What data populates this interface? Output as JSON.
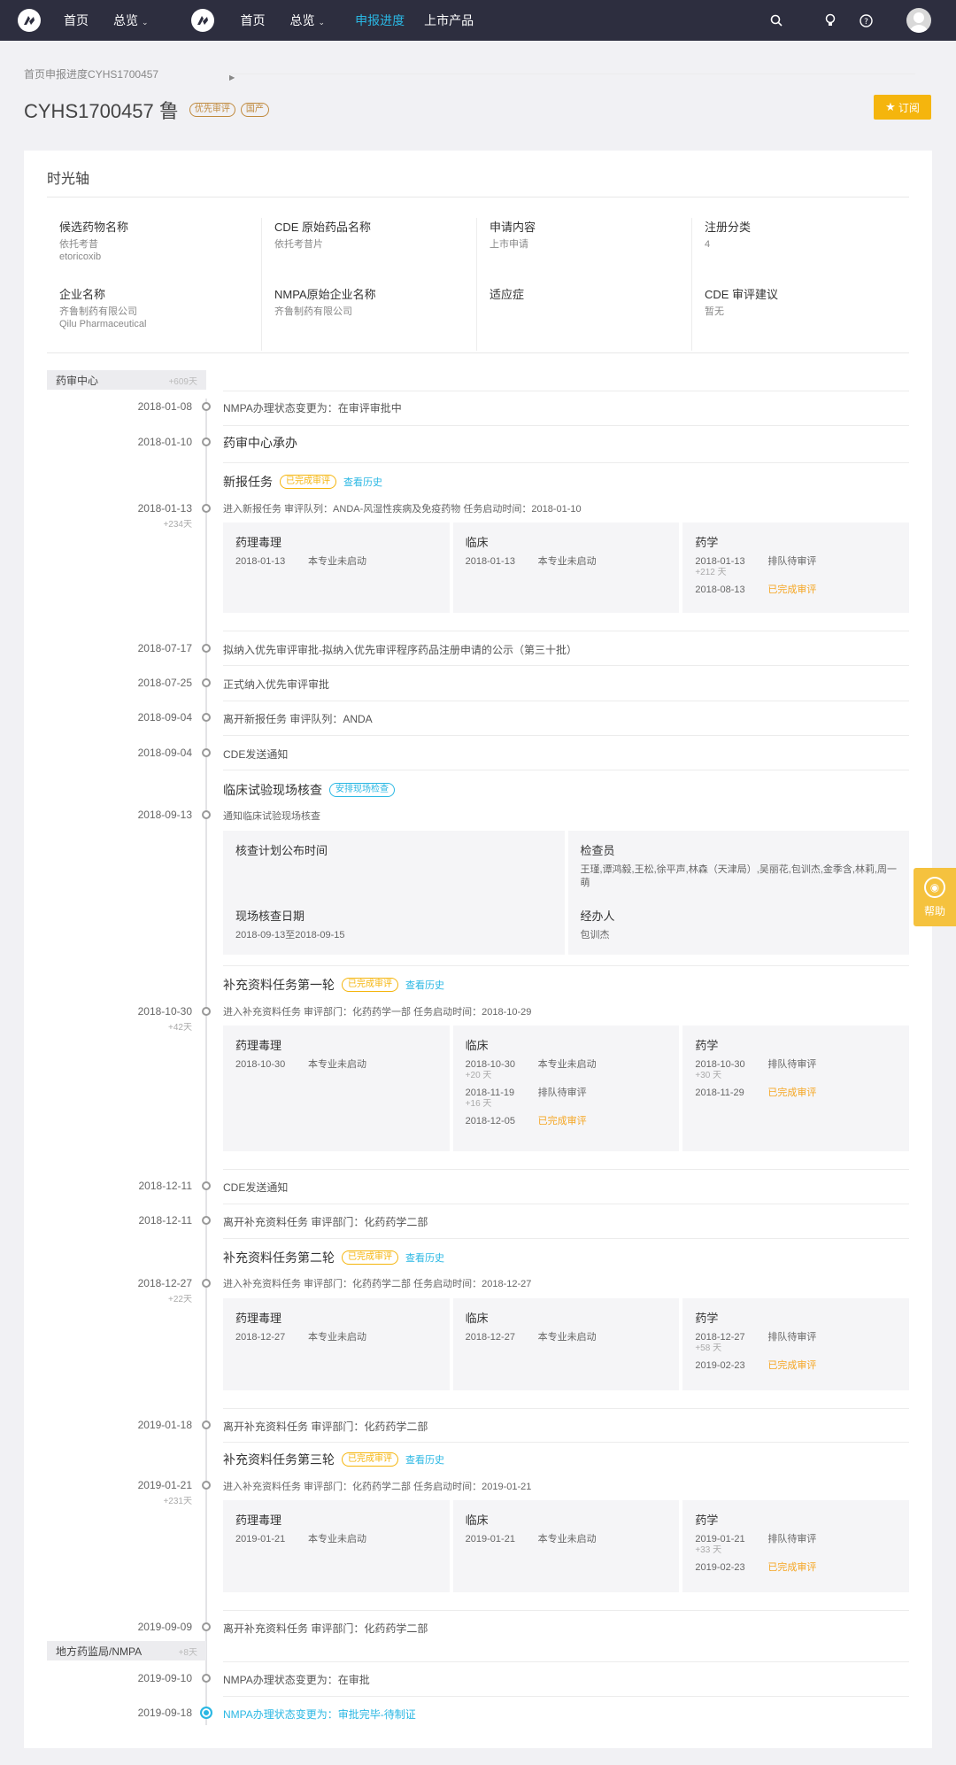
{
  "nav": {
    "left": {
      "home": "首页",
      "overview": "总览"
    },
    "main": {
      "home": "首页",
      "overview": "总览",
      "progress": "申报进度",
      "products": "上市产品"
    }
  },
  "breadcrumb": [
    "首页",
    "申报进度",
    "CYHS1700457"
  ],
  "title": {
    "text": "CYHS1700457 鲁",
    "tags": [
      "优先审评",
      "国产"
    ]
  },
  "subscribe": "订阅",
  "card_title": "时光轴",
  "info": [
    {
      "label": "候选药物名称",
      "value": "依托考昔",
      "value2": "etoricoxib"
    },
    {
      "label": "CDE 原始药品名称",
      "value": "依托考昔片"
    },
    {
      "label": "申请内容",
      "value": "上市申请"
    },
    {
      "label": "注册分类",
      "value": "4"
    },
    {
      "label": "企业名称",
      "value": "齐鲁制药有限公司",
      "value2": "Qilu Pharmaceutical"
    },
    {
      "label": "NMPA原始企业名称",
      "value": "齐鲁制药有限公司"
    },
    {
      "label": "适应症",
      "value": ""
    },
    {
      "label": "CDE 审评建议",
      "value": "暂无"
    }
  ],
  "stages": [
    {
      "label": "药审中心",
      "days": "+609天"
    },
    {
      "label": "地方药监局/NMPA",
      "days": "+8天"
    }
  ],
  "simple_events": [
    {
      "date": "2018-01-08",
      "text": "NMPA办理状态变更为：在审评审批中"
    },
    {
      "date": "2018-01-10",
      "text": "药审中心承办"
    },
    {
      "date": "2018-07-17",
      "text": "拟纳入优先审评审批-拟纳入优先审评程序药品注册申请的公示（第三十批）"
    },
    {
      "date": "2018-07-25",
      "text": "正式纳入优先审评审批"
    },
    {
      "date": "2018-09-04",
      "text": "离开新报任务   审评队列：ANDA"
    },
    {
      "date": "2018-09-04",
      "text": "CDE发送通知"
    },
    {
      "date": "2018-12-11",
      "text": "CDE发送通知"
    },
    {
      "date": "2018-12-11",
      "text": "离开补充资料任务   审评部门：化药药学二部"
    },
    {
      "date": "2019-01-18",
      "text": "离开补充资料任务   审评部门：化药药学二部"
    },
    {
      "date": "2019-09-09",
      "text": "离开补充资料任务   审评部门：化药药学二部"
    },
    {
      "date": "2019-09-10",
      "text": "NMPA办理状态变更为：在审批"
    },
    {
      "date": "2019-09-18",
      "text": "NMPA办理状态变更为：审批完毕-待制证"
    }
  ],
  "tasks": [
    {
      "title": "新报任务",
      "badge": "已完成审评",
      "link": "查看历史",
      "date": "2018-01-13",
      "delta": "+234天",
      "sub": "进入新报任务   审评队列：ANDA-风湿性疾病及免疫药物   任务启动时间：2018-01-10",
      "panels": [
        {
          "name": "药理毒理",
          "rows": [
            {
              "d": "2018-01-13",
              "s": "本专业未启动"
            }
          ]
        },
        {
          "name": "临床",
          "rows": [
            {
              "d": "2018-01-13",
              "s": "本专业未启动"
            }
          ]
        },
        {
          "name": "药学",
          "rows": [
            {
              "d": "2018-01-13",
              "s": "排队待审评",
              "delta": "+212 天"
            },
            {
              "d": "2018-08-13",
              "s": "已完成审评"
            }
          ]
        }
      ]
    },
    {
      "title": "补充资料任务第一轮",
      "badge": "已完成审评",
      "link": "查看历史",
      "date": "2018-10-30",
      "delta": "+42天",
      "sub": "进入补充资料任务   审评部门：化药药学一部   任务启动时间：2018-10-29",
      "panels": [
        {
          "name": "药理毒理",
          "rows": [
            {
              "d": "2018-10-30",
              "s": "本专业未启动"
            }
          ]
        },
        {
          "name": "临床",
          "rows": [
            {
              "d": "2018-10-30",
              "s": "本专业未启动",
              "delta": "+20 天"
            },
            {
              "d": "2018-11-19",
              "s": "排队待审评",
              "delta": "+16 天"
            },
            {
              "d": "2018-12-05",
              "s": "已完成审评"
            }
          ]
        },
        {
          "name": "药学",
          "rows": [
            {
              "d": "2018-10-30",
              "s": "排队待审评",
              "delta": "+30 天"
            },
            {
              "d": "2018-11-29",
              "s": "已完成审评"
            }
          ]
        }
      ]
    },
    {
      "title": "补充资料任务第二轮",
      "badge": "已完成审评",
      "link": "查看历史",
      "date": "2018-12-27",
      "delta": "+22天",
      "sub": "进入补充资料任务   审评部门：化药药学二部   任务启动时间：2018-12-27",
      "panels": [
        {
          "name": "药理毒理",
          "rows": [
            {
              "d": "2018-12-27",
              "s": "本专业未启动"
            }
          ]
        },
        {
          "name": "临床",
          "rows": [
            {
              "d": "2018-12-27",
              "s": "本专业未启动"
            }
          ]
        },
        {
          "name": "药学",
          "rows": [
            {
              "d": "2018-12-27",
              "s": "排队待审评",
              "delta": "+58 天"
            },
            {
              "d": "2019-02-23",
              "s": "已完成审评"
            }
          ]
        }
      ]
    },
    {
      "title": "补充资料任务第三轮",
      "badge": "已完成审评",
      "link": "查看历史",
      "date": "2019-01-21",
      "delta": "+231天",
      "sub": "进入补充资料任务   审评部门：化药药学二部   任务启动时间：2019-01-21",
      "panels": [
        {
          "name": "药理毒理",
          "rows": [
            {
              "d": "2019-01-21",
              "s": "本专业未启动"
            }
          ]
        },
        {
          "name": "临床",
          "rows": [
            {
              "d": "2019-01-21",
              "s": "本专业未启动"
            }
          ]
        },
        {
          "name": "药学",
          "rows": [
            {
              "d": "2019-01-21",
              "s": "排队待审评",
              "delta": "+33 天"
            },
            {
              "d": "2019-02-23",
              "s": "已完成审评"
            }
          ]
        }
      ]
    }
  ],
  "inspection": {
    "title": "临床试验现场核查",
    "badge": "安排现场检查",
    "date": "2018-09-13",
    "sub": "通知临床试验现场核查",
    "plan_label": "核查计划公布时间",
    "plan_value": "",
    "inspector_label": "检查员",
    "inspector_value": "王瑾,谭鸿毅,王松,徐平声,林森（天津局）,吴丽花,包训杰,金季含,林莉,周一萌",
    "site_label": "现场核查日期",
    "site_value": "2018-09-13至2018-09-15",
    "handler_label": "经办人",
    "handler_value": "包训杰"
  },
  "help": "帮助",
  "colors": {
    "nav_bg": "#2d2e3f",
    "accent": "#2ab7e3",
    "yellow": "#f5b50d",
    "done": "#f5a623"
  }
}
